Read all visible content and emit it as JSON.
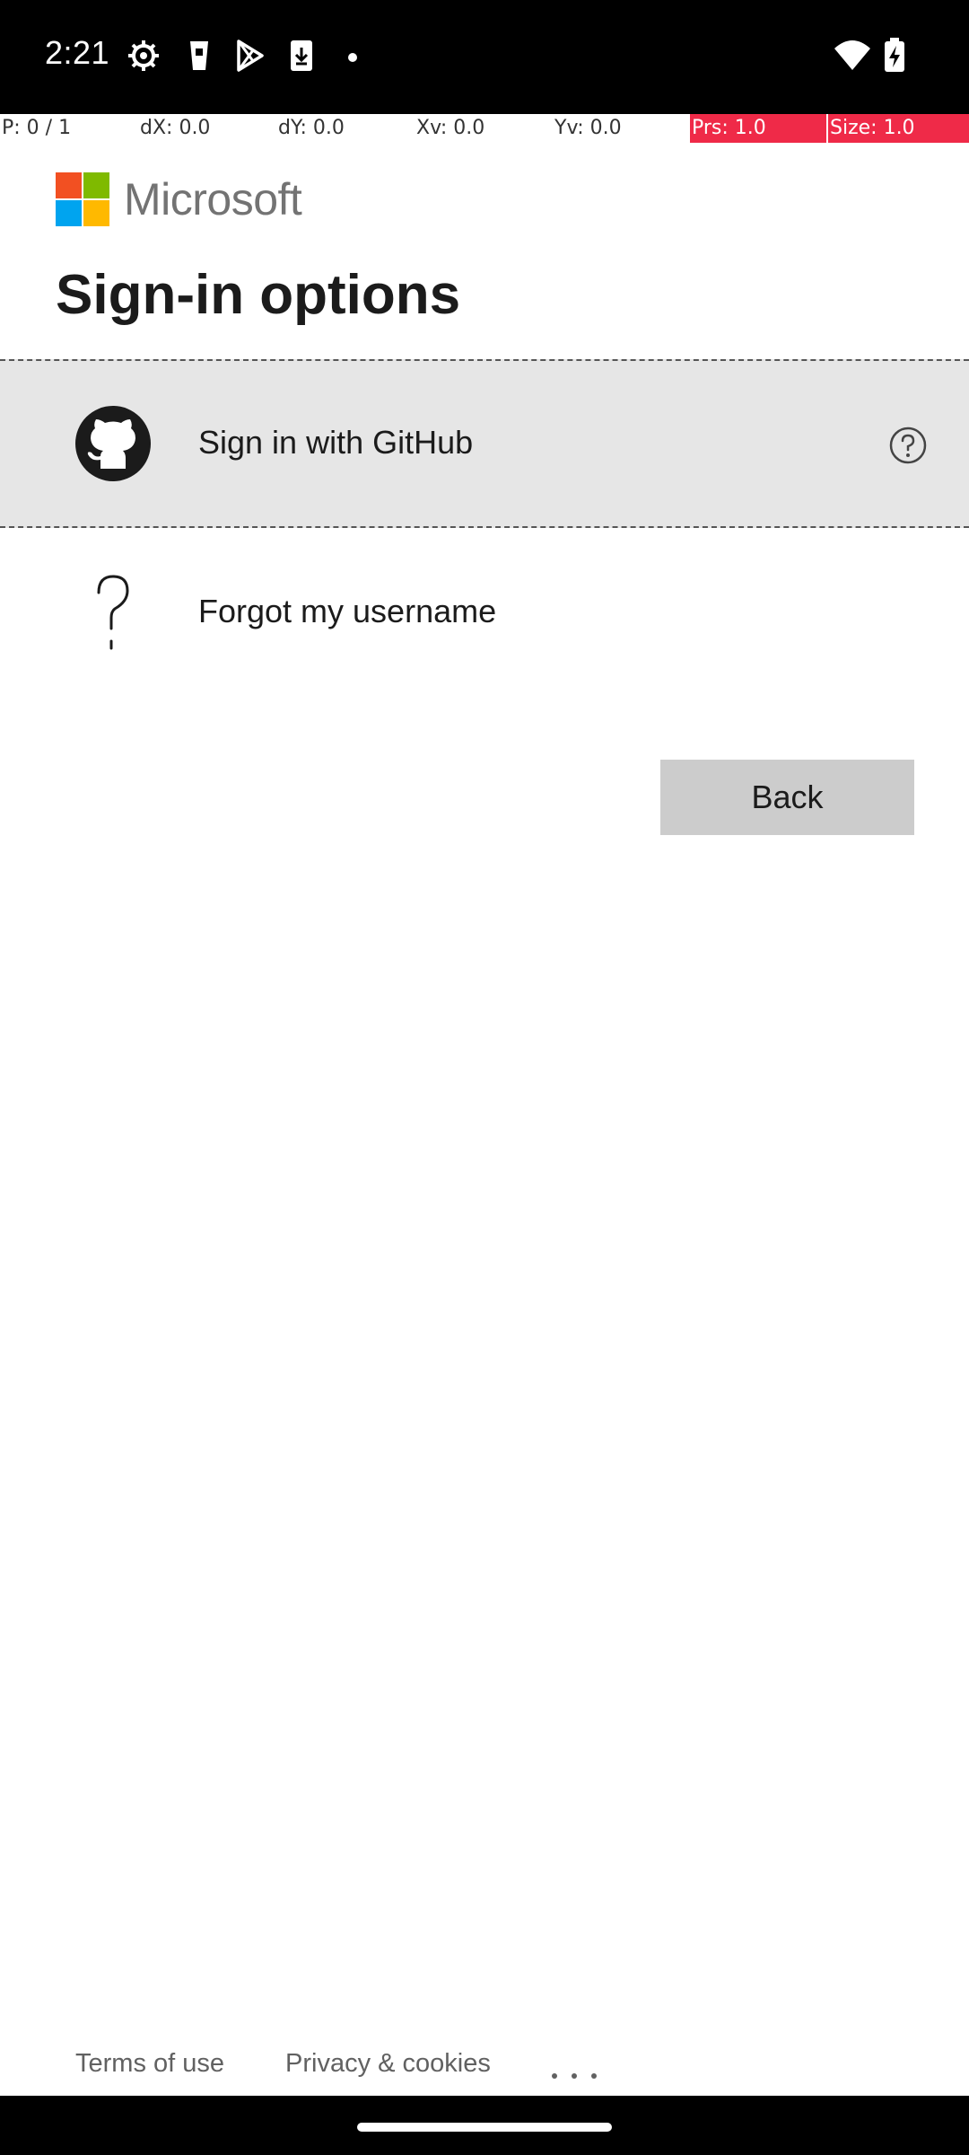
{
  "status_bar": {
    "time": "2:21",
    "left_icons": [
      "settings-gear-icon",
      "cup-icon",
      "play-store-icon",
      "download-icon",
      "dot-icon"
    ],
    "right_icons": [
      "wifi-icon",
      "battery-charging-icon"
    ]
  },
  "pointer_debug": {
    "pointer": "P: 0 / 1",
    "dx": "dX: 0.0",
    "dy": "dY: 0.0",
    "xv": "Xv: 0.0",
    "yv": "Yv: 0.0",
    "prs": "Prs: 1.0",
    "size": "Size: 1.0",
    "highlight_color": "#ef2a48"
  },
  "brand": {
    "name": "Microsoft",
    "colors": [
      "#f25022",
      "#7fba00",
      "#00a4ef",
      "#ffb900"
    ]
  },
  "page": {
    "title": "Sign-in options"
  },
  "options": [
    {
      "label": "Sign in with GitHub",
      "icon": "github-icon",
      "selected": true,
      "help_icon": "help-circle-icon"
    },
    {
      "label": "Forgot my username",
      "icon": "question-mark-icon",
      "selected": false
    }
  ],
  "buttons": {
    "back": "Back"
  },
  "footer": {
    "terms": "Terms of use",
    "privacy": "Privacy & cookies",
    "more_icon": "more-dots-icon"
  }
}
